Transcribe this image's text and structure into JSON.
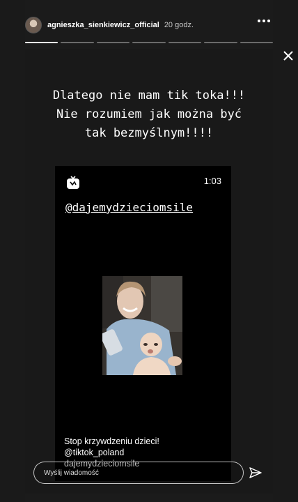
{
  "header": {
    "username": "agnieszka_sienkiewicz_official",
    "time": "20 godz."
  },
  "story": {
    "caption": "Dlatego nie mam tik toka!!! Nie rozumiem jak można być tak bezmyślnym!!!!",
    "video": {
      "duration": "1:03",
      "handle": "@dajemydzieciomsile",
      "line1": "Stop krzywdzeniu dzieci!",
      "line2": "@tiktok_poland",
      "line3": "dajemydzieciomsile"
    }
  },
  "reply": {
    "placeholder": "Wyślij wiadomość"
  },
  "progress": {
    "segments": 7,
    "active_index": 0
  }
}
